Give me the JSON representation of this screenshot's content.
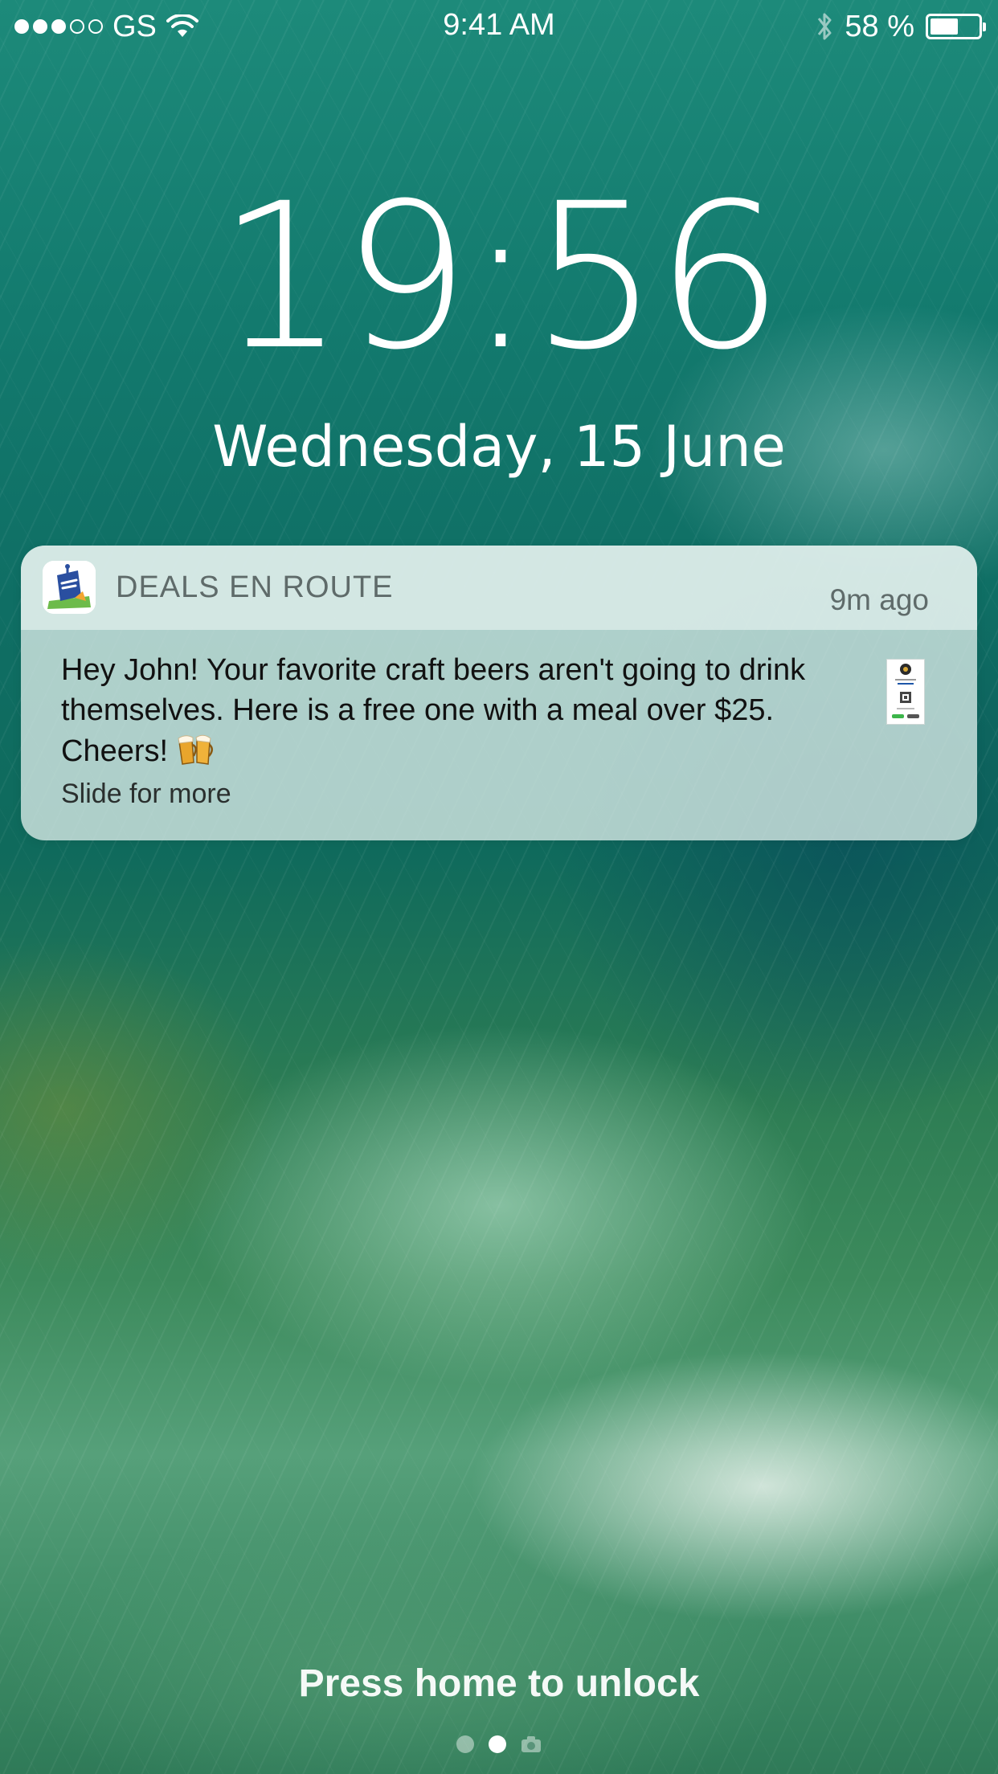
{
  "status_bar": {
    "carrier": "GS",
    "time": "9:41 AM",
    "battery_text": "58 %",
    "battery_level": 0.58,
    "signal_bars_filled": 3,
    "signal_bars_total": 5,
    "icons": [
      "wifi-icon",
      "bluetooth-icon",
      "battery-icon"
    ]
  },
  "lock_screen": {
    "clock": "19:56",
    "date": "Wednesday, 15 June"
  },
  "notification": {
    "app_name": "DEALS EN ROUTE",
    "time_ago": "9m ago",
    "message": "Hey John! Your favorite craft beers aren't going to drink themselves. Here is a free one with a meal over $25. Cheers!",
    "more_hint": "Slide for more",
    "emoji_icon": "beer-mugs-icon",
    "attachment_icon": "coupon-thumbnail-icon"
  },
  "bottom": {
    "unlock_hint": "Press home to unlock",
    "page_count": 3,
    "active_page": 2
  },
  "colors": {
    "notification_bg": "#d6e8e5",
    "app_name_text": "#5f6b6a",
    "wallpaper_teal": "#137a6e"
  }
}
